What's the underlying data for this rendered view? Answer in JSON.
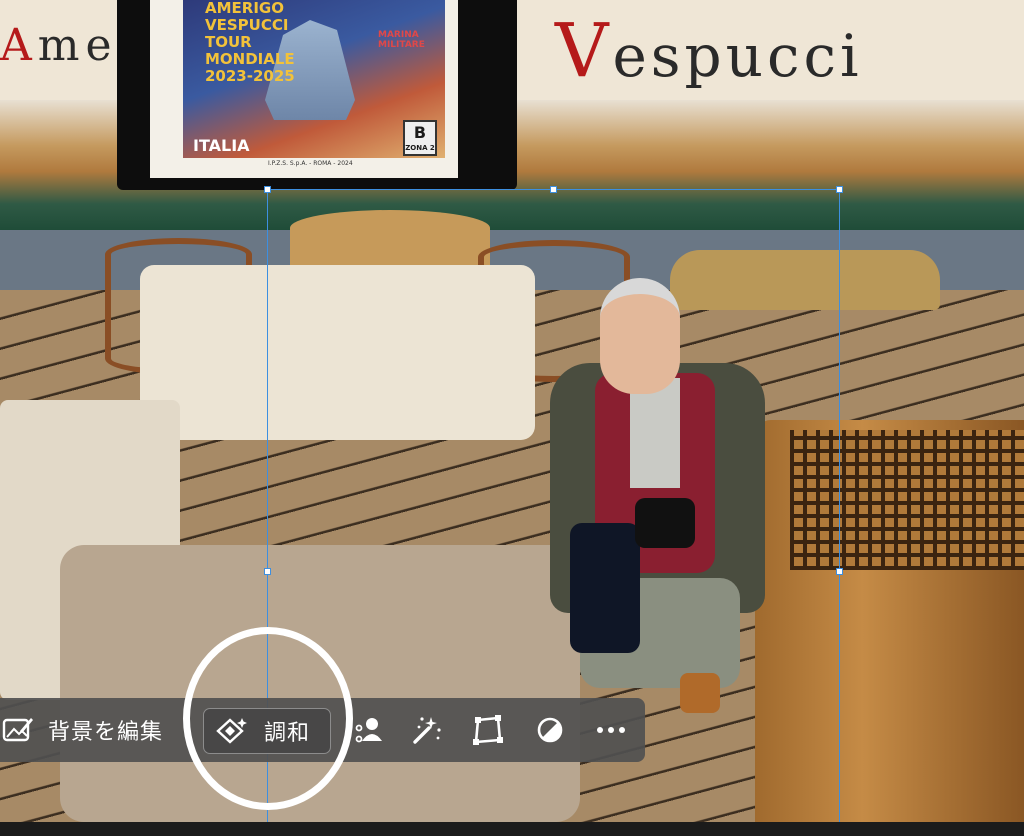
{
  "canvas": {
    "banner_left": "Ame",
    "banner_right": "Vespucci"
  },
  "stamp": {
    "title": "AMERIGO\nVESPUCCI\nTOUR\nMONDIALE\n2023-2025",
    "marina": "MARINA\nMILITARE",
    "country": "ITALIA",
    "denomination": "B",
    "zone": "ZONA 2",
    "footer": "I.P.Z.S. S.p.A. - ROMA - 2024"
  },
  "toolbar": {
    "edit_background_label": "背景を編集",
    "harmonize_label": "調和",
    "icons": [
      "edit-background-icon",
      "harmonize-icon",
      "select-subject-icon",
      "magic-wand-icon",
      "transform-icon",
      "adjust-icon",
      "more-icon"
    ]
  },
  "colors": {
    "selection": "#3d8fe0",
    "toolbar_bg": "#505050",
    "highlight_ring": "#ffffff"
  }
}
